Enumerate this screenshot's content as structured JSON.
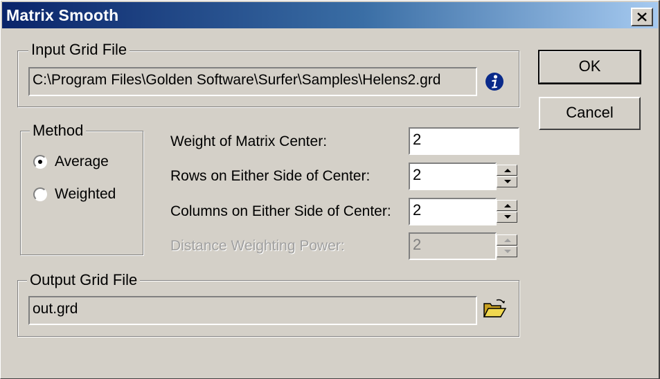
{
  "dialog": {
    "title": "Matrix Smooth",
    "close_glyph": "✕"
  },
  "input_group": {
    "legend": "Input Grid File",
    "path": "C:\\Program Files\\Golden Software\\Surfer\\Samples\\Helens2.grd",
    "info_icon": "info-icon"
  },
  "method_group": {
    "legend": "Method",
    "options": [
      {
        "label": "Average",
        "selected": true
      },
      {
        "label": "Weighted",
        "selected": false
      }
    ]
  },
  "params": {
    "weight_center": {
      "label": "Weight of Matrix Center:",
      "value": "2"
    },
    "rows_each_side": {
      "label": "Rows on Either Side of Center:",
      "value": "2"
    },
    "cols_each_side": {
      "label": "Columns on Either Side of Center:",
      "value": "2"
    },
    "distance_power": {
      "label": "Distance Weighting Power:",
      "value": "2",
      "disabled": true
    }
  },
  "output_group": {
    "legend": "Output Grid File",
    "path": "out.grd",
    "browse_icon": "open-folder-icon"
  },
  "buttons": {
    "ok": "OK",
    "cancel": "Cancel"
  },
  "colors": {
    "title_start": "#0a246a",
    "title_end": "#a6caf0",
    "face": "#d4d0c8",
    "info_blue": "#0a2a8a",
    "folder_yellow": "#e8c838"
  }
}
